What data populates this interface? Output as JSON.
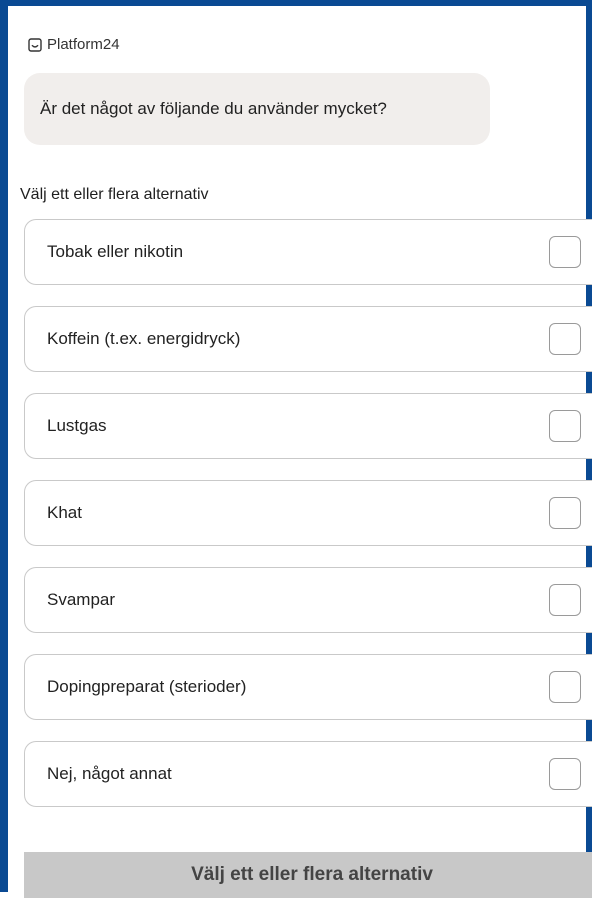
{
  "brand": {
    "name": "Platform24",
    "icon": "smiley-chat-icon"
  },
  "question": "Är det något av följande du använder mycket?",
  "instruction": "Välj ett eller flera alternativ",
  "options": [
    {
      "label": "Tobak eller nikotin",
      "checked": false
    },
    {
      "label": "Koffein (t.ex. energidryck)",
      "checked": false
    },
    {
      "label": "Lustgas",
      "checked": false
    },
    {
      "label": "Khat",
      "checked": false
    },
    {
      "label": "Svampar",
      "checked": false
    },
    {
      "label": "Dopingpreparat (sterioder)",
      "checked": false
    },
    {
      "label": "Nej, något annat",
      "checked": false
    }
  ],
  "submit_label": "Välj ett eller flera alternativ",
  "colors": {
    "frame": "#0a4a93",
    "bubble": "#f1eeec",
    "submit_disabled": "#c8c8c8"
  }
}
